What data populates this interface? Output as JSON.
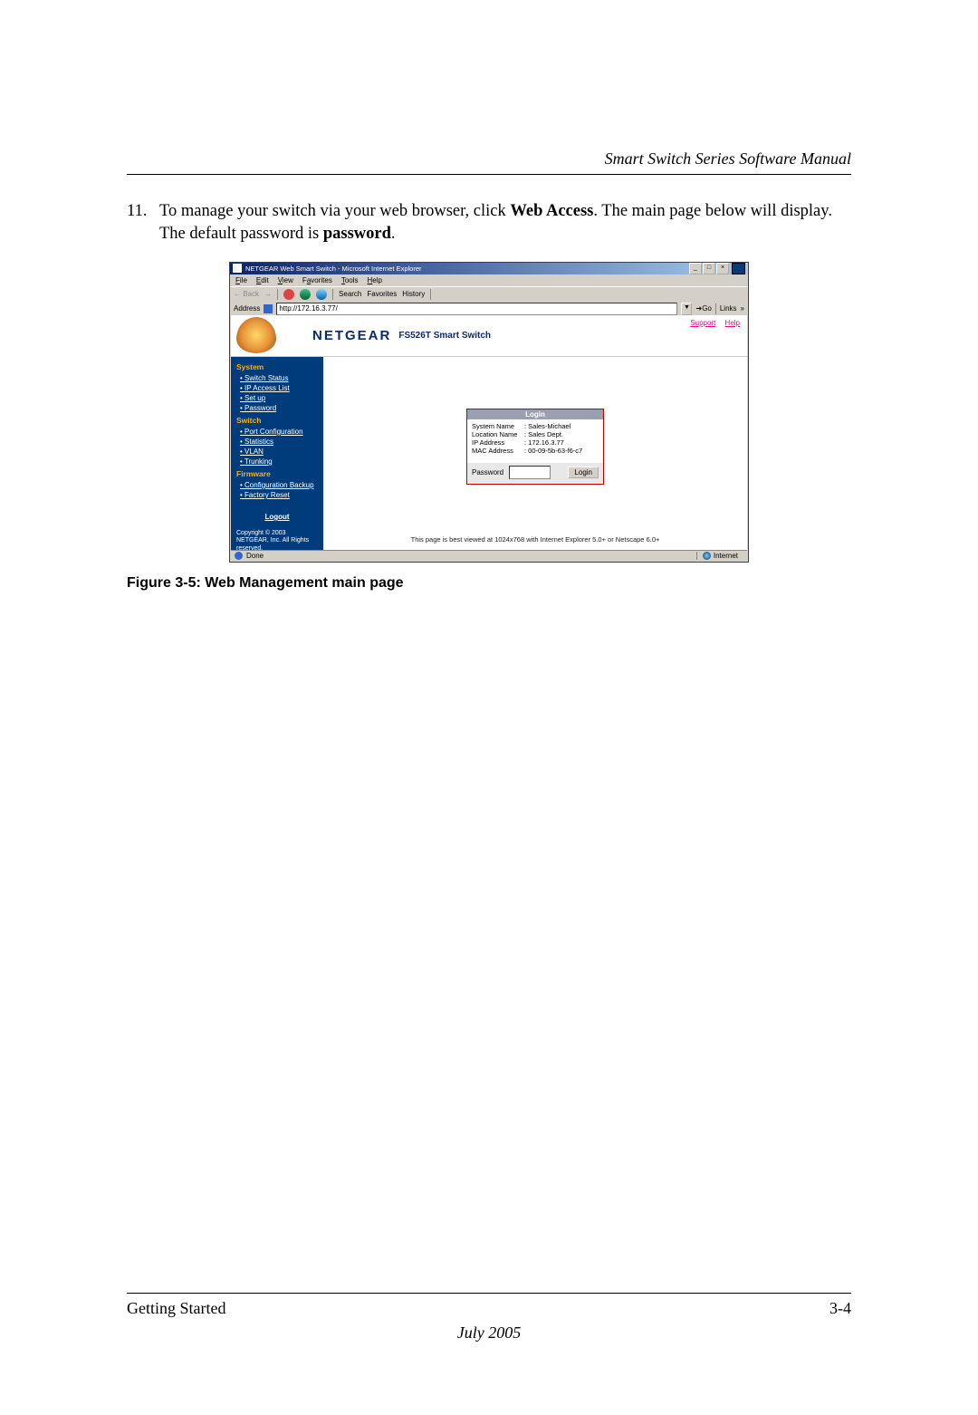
{
  "doc": {
    "header_title": "Smart Switch Series Software Manual",
    "step_number": "11.",
    "step_text_pre": "To manage your switch via your web browser, click ",
    "step_text_bold1": "Web Access",
    "step_text_mid": ". The main page below will display. The default password is ",
    "step_text_bold2": "password",
    "step_text_post": ".",
    "figure_caption": "Figure 3-5:  Web Management main page",
    "footer_left": "Getting Started",
    "footer_right": "3-4",
    "footer_date": "July 2005"
  },
  "ie": {
    "title": "NETGEAR Web Smart Switch - Microsoft Internet Explorer",
    "menu": {
      "file": "File",
      "edit": "Edit",
      "view": "View",
      "favorites": "Favorites",
      "tools": "Tools",
      "help": "Help"
    },
    "toolbar": {
      "back": "Back",
      "search": "Search",
      "favorites": "Favorites",
      "history": "History"
    },
    "address_label": "Address",
    "address_value": "http://172.16.3.77/",
    "go_label": "Go",
    "links_label": "Links",
    "status_done": "Done",
    "status_zone": "Internet",
    "window_buttons": {
      "min": "_",
      "max": "□",
      "close": "×"
    }
  },
  "netgear": {
    "brand": "NETGEAR",
    "model": "FS526T Smart Switch",
    "top_links": {
      "support": "Support",
      "help": "Help"
    },
    "sections": {
      "system_head": "System",
      "system_items": [
        "Switch Status",
        "IP Access List",
        "Set up",
        "Password"
      ],
      "switch_head": "Switch",
      "switch_items": [
        "Port Configuration",
        "Statistics",
        "VLAN",
        "Trunking"
      ],
      "firmware_head": "Firmware",
      "firmware_items": [
        "Configuration Backup",
        "Factory Reset"
      ]
    },
    "logout": "Logout",
    "copyright": "Copyright © 2003 NETGEAR, Inc. All Rights reserved.",
    "login": {
      "title": "Login",
      "system_name_k": "System Name",
      "system_name_v": ": Sales-Michael",
      "location_k": "Location Name",
      "location_v": ": Sales Dept.",
      "ip_k": "IP Address",
      "ip_v": ": 172.16.3.77",
      "mac_k": "MAC Address",
      "mac_v": ": 00-09-5b-63-f6-c7",
      "password_label": "Password",
      "login_button": "Login"
    },
    "best_viewed": "This page is best viewed at 1024x768 with Internet Explorer 5.0+ or Netscape 6.0+"
  }
}
